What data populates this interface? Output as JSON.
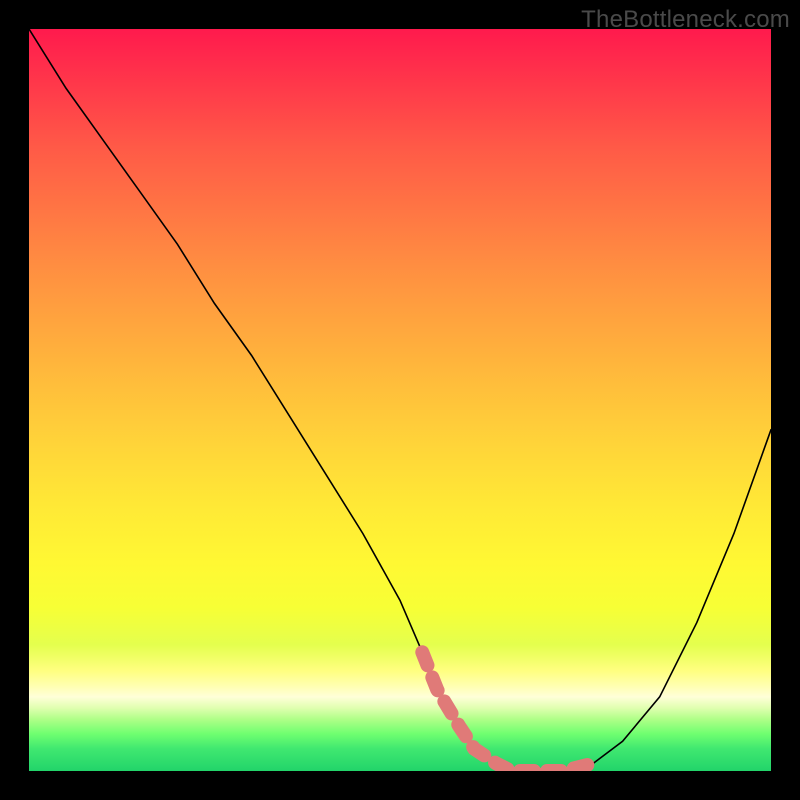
{
  "watermark": "TheBottleneck.com",
  "chart_data": {
    "type": "line",
    "title": "",
    "xlabel": "",
    "ylabel": "",
    "xlim": [
      0,
      100
    ],
    "ylim": [
      0,
      100
    ],
    "series": [
      {
        "name": "bottleneck-curve",
        "x": [
          0,
          5,
          10,
          15,
          20,
          25,
          30,
          35,
          40,
          45,
          50,
          53,
          55,
          58,
          60,
          63,
          65,
          68,
          72,
          76,
          80,
          85,
          90,
          95,
          100
        ],
        "y": [
          100,
          92,
          85,
          78,
          71,
          63,
          56,
          48,
          40,
          32,
          23,
          16,
          11,
          6,
          3,
          1,
          0,
          0,
          0,
          1,
          4,
          10,
          20,
          32,
          46
        ]
      }
    ],
    "highlight_segment": {
      "name": "optimal-range",
      "x": [
        53,
        55,
        58,
        60,
        63,
        65,
        68,
        72,
        76
      ],
      "y": [
        16,
        11,
        6,
        3,
        1,
        0,
        0,
        0,
        1
      ]
    },
    "colors": {
      "curve": "#000000",
      "highlight": "#e07a78",
      "gradient_top": "#ff1a4d",
      "gradient_mid": "#ffe836",
      "gradient_bottom": "#22d46a"
    }
  }
}
